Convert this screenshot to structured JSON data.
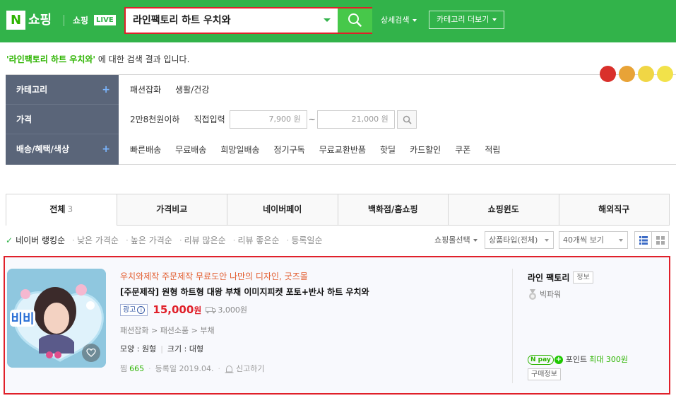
{
  "header": {
    "logo_n": "N",
    "logo_text": "쇼핑",
    "live_label": "쇼핑",
    "live_badge": "LIVE",
    "search_value": "라인팩토리 하트 우치와",
    "advanced_search": "상세검색",
    "more_categories": "카테고리 더보기",
    "brand_color": "#32b34a",
    "highlight_color": "#e0202a"
  },
  "result": {
    "query": "'라인팩토리 하트 우치와'",
    "suffix": " 에 대한 검색 결과 입니다."
  },
  "filters": {
    "category_label": "카테고리",
    "categories": [
      "패션잡화",
      "생활/건강"
    ],
    "price_label": "가격",
    "price_preset": "2만8천원이하",
    "price_direct": "직접입력",
    "price_min": "7,900 원",
    "price_max": "21,000 원",
    "price_tilde": "~",
    "benefit_label": "배송/혜택/색상",
    "benefits": [
      "빠른배송",
      "무료배송",
      "희망일배송",
      "정기구독",
      "무료교환반품",
      "핫딜",
      "카드할인",
      "쿠폰",
      "적립"
    ],
    "colors": [
      "#d9302b",
      "#e8a337",
      "#f0d645",
      "#f2e24a"
    ]
  },
  "tabs": [
    {
      "label": "전체",
      "count": "3"
    },
    {
      "label": "가격비교",
      "count": ""
    },
    {
      "label": "네이버페이",
      "count": ""
    },
    {
      "label": "백화점/홈쇼핑",
      "count": ""
    },
    {
      "label": "쇼핑윈도",
      "count": ""
    },
    {
      "label": "해외직구",
      "count": ""
    }
  ],
  "sort": {
    "options": [
      "네이버 랭킹순",
      "낮은 가격순",
      "높은 가격순",
      "리뷰 많은순",
      "리뷰 좋은순",
      "등록일순"
    ],
    "mall_select": "쇼핑몰선택",
    "product_type": "상품타입(전체)",
    "per_page": "40개씩 보기"
  },
  "product": {
    "ad_title": "우치와제작 주문제작 무료도안 나만의 디자인, 굿즈몰",
    "title": "[주문제작] 원형 하트형 대왕 부채 이미지피켓 포토+반사 하트 우치와",
    "ad_badge": "광고",
    "ad_info": "i",
    "price": "15,000",
    "price_unit": "원",
    "shipping": "3,000원",
    "breadcrumb": "패션잡화 > 패션소품 > 부채",
    "shape_attr": "모양 : 원형",
    "size_attr": "크기 : 대형",
    "zzim_label": "찜",
    "zzim_count": "665",
    "registered": "등록일 2019.04.",
    "report": "신고하기",
    "thumb_text": "비비"
  },
  "seller": {
    "name": "라인 팩토리",
    "info_tag": "정보",
    "grade": "빅파워",
    "npay_logo": "N pay",
    "npay_plus": "+",
    "point_label": "포인트",
    "point_value": "최대 300원",
    "buy_info": "구매정보"
  }
}
